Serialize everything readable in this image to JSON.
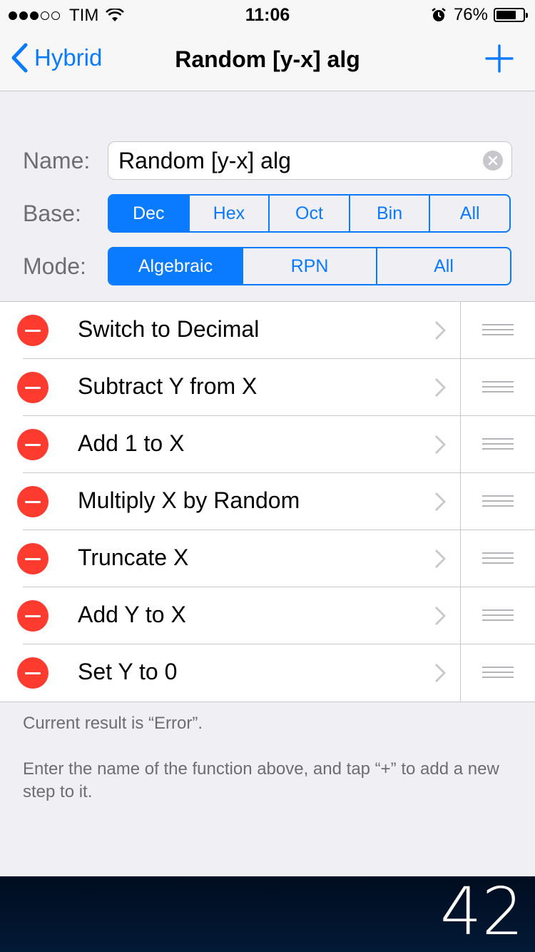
{
  "status_bar": {
    "carrier": "TIM",
    "time": "11:06",
    "battery_percent": "76%",
    "battery_level": 0.76,
    "signal_bars": 3,
    "signal_total": 5
  },
  "nav": {
    "back_label": "Hybrid",
    "title": "Random [y-x] alg",
    "add_icon": "plus-icon",
    "accent_color": "#0a7aff"
  },
  "form": {
    "name_label": "Name:",
    "name_value": "Random [y-x] alg",
    "base_label": "Base:",
    "base_options": [
      "Dec",
      "Hex",
      "Oct",
      "Bin",
      "All"
    ],
    "base_selected": "Dec",
    "mode_label": "Mode:",
    "mode_options": [
      "Algebraic",
      "RPN",
      "All"
    ],
    "mode_selected": "Algebraic"
  },
  "steps": [
    {
      "label": "Switch to Decimal"
    },
    {
      "label": "Subtract Y from X"
    },
    {
      "label": "Add 1 to X"
    },
    {
      "label": "Multiply X by Random"
    },
    {
      "label": "Truncate X"
    },
    {
      "label": "Add Y to X"
    },
    {
      "label": "Set Y to 0"
    }
  ],
  "footer": {
    "result_text": "Current result is “Error”.",
    "help_text": "Enter the name of the function above, and tap “+” to add a new step to it."
  },
  "display": {
    "value": "42"
  },
  "colors": {
    "delete_red": "#ff3b30",
    "background": "#efeff4"
  }
}
